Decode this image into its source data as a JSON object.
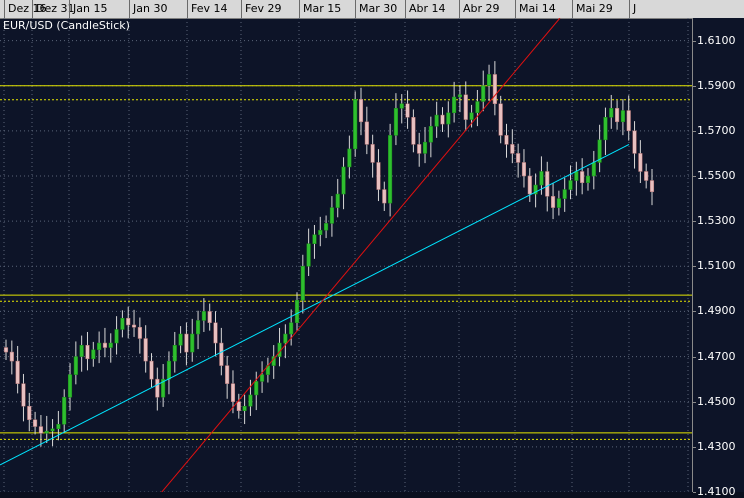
{
  "title": "EUR/USD (CandleStick)",
  "chart_data": {
    "type": "candlestick",
    "title": "EUR/USD (CandleStick)",
    "ylim": [
      1.41,
      1.62
    ],
    "x_tick_labels": [
      "Dez 16",
      "Dez 31",
      "Jan 15",
      "Jan 30",
      "Fev 14",
      "Fev 29",
      "Mar 15",
      "Mar 30",
      "Abr 14",
      "Abr 29",
      "Mai 14",
      "Mai 29",
      "J"
    ],
    "y_tick_labels": [
      "1.6100",
      "1.5900",
      "1.5700",
      "1.5500",
      "1.5300",
      "1.5100",
      "1.4900",
      "1.4700",
      "1.4500",
      "1.4300",
      "1.4100"
    ],
    "horizontal_levels": [
      1.59,
      1.5838,
      1.4972,
      1.4945,
      1.4362,
      1.4333
    ],
    "closes": [
      1.472,
      1.468,
      1.458,
      1.448,
      1.442,
      1.439,
      1.436,
      1.437,
      1.438,
      1.44,
      1.452,
      1.462,
      1.47,
      1.475,
      1.469,
      1.473,
      1.476,
      1.474,
      1.476,
      1.482,
      1.487,
      1.484,
      1.483,
      1.478,
      1.468,
      1.46,
      1.452,
      1.46,
      1.468,
      1.475,
      1.48,
      1.472,
      1.48,
      1.486,
      1.49,
      1.485,
      1.476,
      1.466,
      1.458,
      1.45,
      1.446,
      1.448,
      1.453,
      1.459,
      1.462,
      1.466,
      1.47,
      1.476,
      1.48,
      1.485,
      1.495,
      1.51,
      1.52,
      1.524,
      1.526,
      1.529,
      1.536,
      1.542,
      1.554,
      1.562,
      1.584,
      1.574,
      1.564,
      1.556,
      1.544,
      1.538,
      1.568,
      1.58,
      1.582,
      1.576,
      1.564,
      1.56,
      1.565,
      1.572,
      1.577,
      1.573,
      1.578,
      1.585,
      1.586,
      1.575,
      1.578,
      1.583,
      1.59,
      1.595,
      1.582,
      1.568,
      1.564,
      1.56,
      1.556,
      1.55,
      1.542,
      1.546,
      1.552,
      1.541,
      1.536,
      1.54,
      1.544,
      1.548,
      1.552,
      1.547,
      1.55,
      1.556,
      1.566,
      1.576,
      1.58,
      1.574,
      1.579,
      1.57,
      1.56,
      1.552,
      1.548,
      1.543
    ],
    "trendlines": [
      {
        "color": "#00e5ff",
        "from": [
          "Dez 16",
          1.422
        ],
        "to": [
          "J",
          1.564
        ]
      },
      {
        "color": "#e01010",
        "from": [
          "Fev 14",
          1.408
        ],
        "to": [
          "Abr 29",
          1.62
        ]
      }
    ]
  }
}
